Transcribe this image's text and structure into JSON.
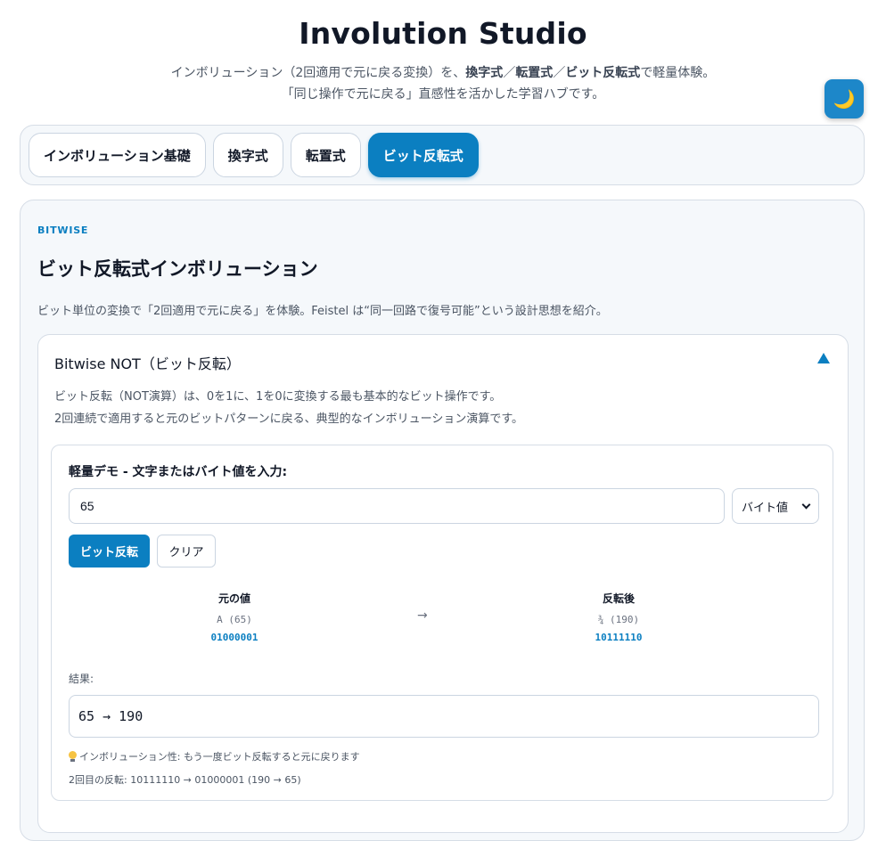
{
  "app": {
    "title": "Involution Studio",
    "subtitle_pre": "インボリューション（2回適用で元に戻る変換）を、",
    "subtitle_b1": "換字式",
    "subtitle_sep1": "／",
    "subtitle_b2": "転置式",
    "subtitle_sep2": "／",
    "subtitle_b3": "ビット反転式",
    "subtitle_post": "で軽量体験。",
    "subtitle_line2": "「同じ操作で元に戻る」直感性を活かした学習ハブです。",
    "theme_icon": "moon-icon",
    "theme_glyph": "🌙"
  },
  "tabs": [
    {
      "label": "インボリューション基礎",
      "active": false
    },
    {
      "label": "換字式",
      "active": false
    },
    {
      "label": "転置式",
      "active": false
    },
    {
      "label": "ビット反転式",
      "active": true
    }
  ],
  "section": {
    "eyebrow": "BITWISE",
    "title": "ビット反転式インボリューション",
    "description": "ビット単位の変換で「2回適用で元に戻る」を体験。Feistel は“同一回路で復号可能”という設計思想を紹介。"
  },
  "card": {
    "title": "Bitwise NOT（ビット反転）",
    "collapse_icon": "triangle-up-icon",
    "desc_line1": "ビット反転（NOT演算）は、0を1に、1を0に変換する最も基本的なビット操作です。",
    "desc_line2": "2回連続で適用すると元のビットパターンに戻る、典型的なインボリューション演算です。"
  },
  "demo": {
    "label": "軽量デモ - 文字またはバイト値を入力:",
    "input_value": "65",
    "mode_selected": "バイト値",
    "invert_button": "ビット反転",
    "clear_button": "クリア",
    "original_head": "元の値",
    "original_value": "A (65)",
    "original_bits": "01000001",
    "arrow": "→",
    "inverted_head": "反転後",
    "inverted_value": "¾ (190)",
    "inverted_bits": "10111110",
    "result_label": "結果:",
    "result_text": "65 → 190",
    "hint_icon": "lightbulb-icon",
    "hint_text": "インボリューション性: もう一度ビット反転すると元に戻ります",
    "second_inversion": "2回目の反転: 10111110 → 01000001 (190 → 65)"
  },
  "colors": {
    "accent": "#0b7fc1",
    "panel_bg": "#f5f8fb",
    "border": "#d6dde6",
    "moon": "#f6c343"
  }
}
